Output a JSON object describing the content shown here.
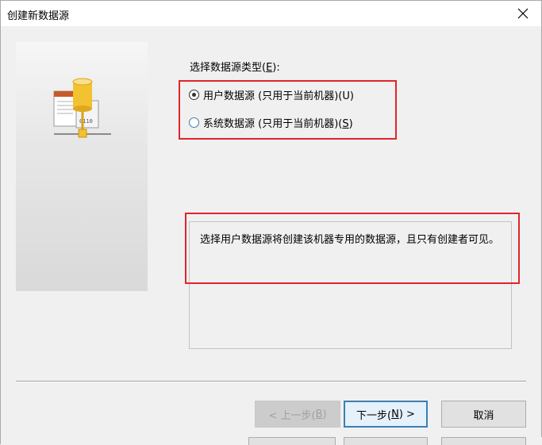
{
  "window": {
    "title": "创建新数据源",
    "close_icon": "close-icon"
  },
  "side_panel": {
    "icon": "database-document-icon"
  },
  "content": {
    "type_label": "选择数据源类型(",
    "type_label_key": "E",
    "type_label_suffix": "):",
    "options": [
      {
        "label": "用户数据源 (只用于当前机器)(U)",
        "checked": true
      },
      {
        "label_prefix": "系统数据源 (只用于当前机器)(",
        "label_key": "S",
        "label_suffix": ")",
        "checked": false
      }
    ],
    "description": "选择用户数据源将创建该机器专用的数据源，且只有创建者可见。"
  },
  "buttons": {
    "back_prefix": "< 上一步(",
    "back_key": "B",
    "back_suffix": ")",
    "next_prefix": "下一步(",
    "next_key": "N",
    "next_suffix": ") >",
    "cancel": "取消"
  },
  "colors": {
    "highlight_box": "#e0242a",
    "accent": "#3c7fb1",
    "background": "#f0f0f0"
  }
}
